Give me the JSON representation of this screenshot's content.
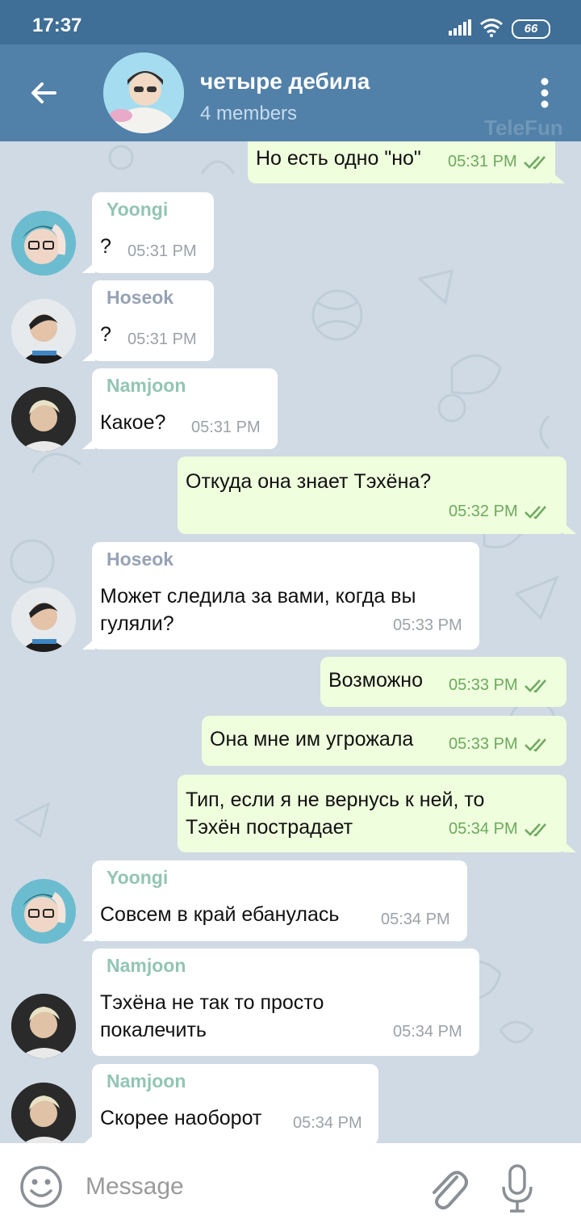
{
  "status_bar": {
    "time": "17:37",
    "battery": "66"
  },
  "header": {
    "title": "четыре дебила",
    "subtitle": "4 members",
    "watermark": "TeleFun"
  },
  "messages": [
    {
      "dir": "out",
      "text": "Но есть одно \"но\"",
      "time": "05:31 PM"
    },
    {
      "dir": "in",
      "sender": "Yoongi",
      "sender_color": "#92c5b3",
      "text": "?",
      "time": "05:31 PM"
    },
    {
      "dir": "in",
      "sender": "Hoseok",
      "sender_color": "#97a2b4",
      "text": "?",
      "time": "05:31 PM"
    },
    {
      "dir": "in",
      "sender": "Namjoon",
      "sender_color": "#92c5b3",
      "text": "Какое?",
      "time": "05:31 PM"
    },
    {
      "dir": "out",
      "text": "Откуда она знает Тэхёна?",
      "time": "05:32 PM"
    },
    {
      "dir": "in",
      "sender": "Hoseok",
      "sender_color": "#97a2b4",
      "text": "Может следила за вами, когда вы гуляли?",
      "time": "05:33 PM"
    },
    {
      "dir": "out",
      "text": "Возможно",
      "time": "05:33 PM"
    },
    {
      "dir": "out",
      "text": "Она мне им угрожала",
      "time": "05:33 PM"
    },
    {
      "dir": "out",
      "text": "Тип, если я не вернусь к ней, то Тэхён пострадает",
      "time": "05:34 PM"
    },
    {
      "dir": "in",
      "sender": "Yoongi",
      "sender_color": "#92c5b3",
      "text": "Совсем в край ебанулась",
      "time": "05:34 PM"
    },
    {
      "dir": "in",
      "sender": "Namjoon",
      "sender_color": "#92c5b3",
      "text": "Тэхёна не так то просто покалечить",
      "time": "05:34 PM"
    },
    {
      "dir": "in",
      "sender": "Namjoon",
      "sender_color": "#92c5b3",
      "text": "Скорее наоборот",
      "time": "05:34 PM"
    }
  ],
  "lines": {
    "m5_l1": "Может следила за вами, когда вы",
    "m5_l2": "гуляли?",
    "m8_l1": "Тип, если я не вернусь к ней, то",
    "m8_l2": "Тэхён пострадает",
    "m10_l1": "Тэхёна не так то просто",
    "m10_l2": "покалечить"
  },
  "composer": {
    "placeholder": "Message"
  },
  "colors": {
    "header": "#5180a8",
    "status_bar": "#3f6e96",
    "outgoing": "#effedd",
    "incoming": "#ffffff",
    "read_ticks": "#6da95e"
  },
  "icons": [
    "back-arrow-icon",
    "more-vert-icon",
    "emoji-icon",
    "attach-paperclip-icon",
    "microphone-icon",
    "double-check-icon"
  ]
}
